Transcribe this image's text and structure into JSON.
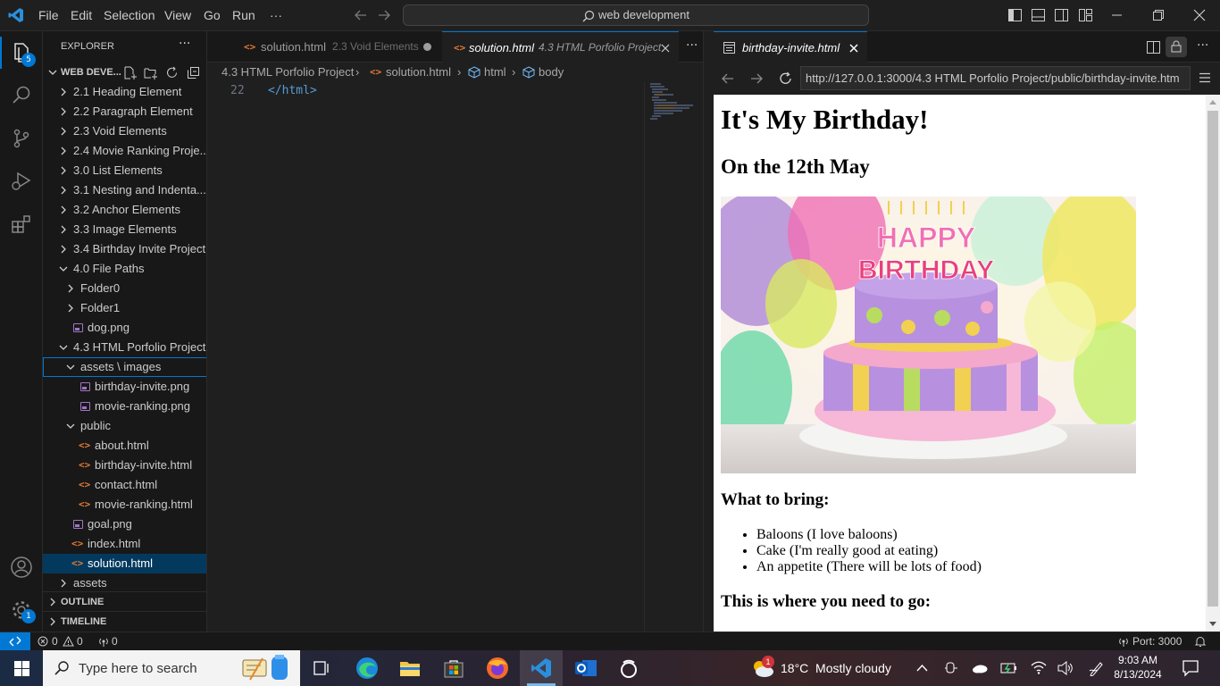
{
  "titlebar": {
    "menu": [
      "File",
      "Edit",
      "Selection",
      "View",
      "Go",
      "Run",
      "···"
    ],
    "search": "web development"
  },
  "activity": {
    "explorer_badge": "5",
    "settings_badge": "1"
  },
  "explorer": {
    "title": "EXPLORER",
    "more": "···",
    "workspace": "WEB DEVE...",
    "tree": [
      {
        "label": "2.1 Heading Element",
        "kind": "folder",
        "open": false,
        "depth": 1
      },
      {
        "label": "2.2 Paragraph Element",
        "kind": "folder",
        "open": false,
        "depth": 1
      },
      {
        "label": "2.3 Void Elements",
        "kind": "folder",
        "open": false,
        "depth": 1
      },
      {
        "label": "2.4 Movie Ranking Proje...",
        "kind": "folder",
        "open": false,
        "depth": 1
      },
      {
        "label": "3.0 List Elements",
        "kind": "folder",
        "open": false,
        "depth": 1
      },
      {
        "label": "3.1 Nesting and Indenta...",
        "kind": "folder",
        "open": false,
        "depth": 1
      },
      {
        "label": "3.2 Anchor Elements",
        "kind": "folder",
        "open": false,
        "depth": 1
      },
      {
        "label": "3.3 Image Elements",
        "kind": "folder",
        "open": false,
        "depth": 1
      },
      {
        "label": "3.4 Birthday Invite Project",
        "kind": "folder",
        "open": false,
        "depth": 1
      },
      {
        "label": "4.0 File Paths",
        "kind": "folder",
        "open": true,
        "depth": 1
      },
      {
        "label": "Folder0",
        "kind": "folder",
        "open": false,
        "depth": 2
      },
      {
        "label": "Folder1",
        "kind": "folder",
        "open": false,
        "depth": 2
      },
      {
        "label": "dog.png",
        "kind": "image",
        "depth": 2
      },
      {
        "label": "4.3 HTML Porfolio Project",
        "kind": "folder",
        "open": true,
        "depth": 1
      },
      {
        "label": "assets \\ images",
        "kind": "folder",
        "open": true,
        "depth": 2,
        "focused": true
      },
      {
        "label": "birthday-invite.png",
        "kind": "image",
        "depth": 3
      },
      {
        "label": "movie-ranking.png",
        "kind": "image",
        "depth": 3
      },
      {
        "label": "public",
        "kind": "folder",
        "open": true,
        "depth": 2
      },
      {
        "label": "about.html",
        "kind": "html",
        "depth": 3
      },
      {
        "label": "birthday-invite.html",
        "kind": "html",
        "depth": 3
      },
      {
        "label": "contact.html",
        "kind": "html",
        "depth": 3
      },
      {
        "label": "movie-ranking.html",
        "kind": "html",
        "depth": 3
      },
      {
        "label": "goal.png",
        "kind": "image",
        "depth": 2
      },
      {
        "label": "index.html",
        "kind": "html",
        "depth": 2
      },
      {
        "label": "solution.html",
        "kind": "html",
        "depth": 2,
        "selected": true
      },
      {
        "label": "assets",
        "kind": "folder",
        "open": false,
        "depth": 1
      }
    ],
    "outline": "OUTLINE",
    "timeline": "TIMELINE"
  },
  "editor": {
    "tabs": [
      {
        "name": "solution.html",
        "desc": "2.3 Void Elements",
        "active": false,
        "dirty": true
      },
      {
        "name": "solution.html",
        "desc": "4.3 HTML Porfolio Project",
        "active": true,
        "dirty": false
      }
    ],
    "tab_more": "···",
    "breadcrumb": [
      "4.3 HTML Porfolio Project",
      "solution.html",
      "html",
      "body"
    ],
    "line_number": "22",
    "line_code": "</html>"
  },
  "preview": {
    "tab": "birthday-invite.html",
    "url": "http://127.0.0.1:3000/4.3 HTML Porfolio Project/public/birthday-invite.htm",
    "page": {
      "h1": "It's My Birthday!",
      "h2": "On the 12th May",
      "cake_text": "HAPPY BIRTHDAY",
      "h3a": "What to bring:",
      "items": [
        "Baloons (I love baloons)",
        "Cake (I'm really good at eating)",
        "An appetite (There will be lots of food)"
      ],
      "h3b": "This is where you need to go:"
    }
  },
  "status": {
    "errors": "0",
    "warnings": "0",
    "ports": "0",
    "port": "Port: 3000"
  },
  "taskbar": {
    "search": "Type here to search",
    "weather_badge": "1",
    "weather": "18°C  Mostly cloudy",
    "time": "9:03 AM",
    "date": "8/13/2024"
  }
}
